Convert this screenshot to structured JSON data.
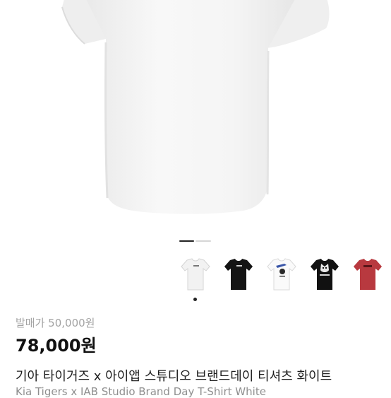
{
  "gallery": {
    "active_index": 0,
    "total_slides": 2,
    "thumbnails": [
      {
        "label": "white-tee-thumbnail",
        "shirt_color": "#f2f2f2",
        "print": "small-text"
      },
      {
        "label": "black-tee-thumbnail",
        "shirt_color": "#141414",
        "print": "small-text"
      },
      {
        "label": "white-tee-graphic-thumbnail",
        "shirt_color": "#fafafa",
        "print": "graphic"
      },
      {
        "label": "black-tee-graphic-thumbnail",
        "shirt_color": "#111111",
        "print": "graphic"
      },
      {
        "label": "red-tee-thumbnail",
        "shirt_color": "#b8393f",
        "print": "logo"
      }
    ]
  },
  "product": {
    "original_price": "발매가 50,000원",
    "price": "78,000원",
    "title_ko": "기아 타이거즈 x 아이앱 스튜디오 브랜드데이 티셔츠 화이트",
    "title_en": "Kia Tigers x IAB Studio Brand Day T-Shirt White"
  },
  "colors": {
    "accent": "#222222",
    "muted": "#a3a3a3"
  }
}
